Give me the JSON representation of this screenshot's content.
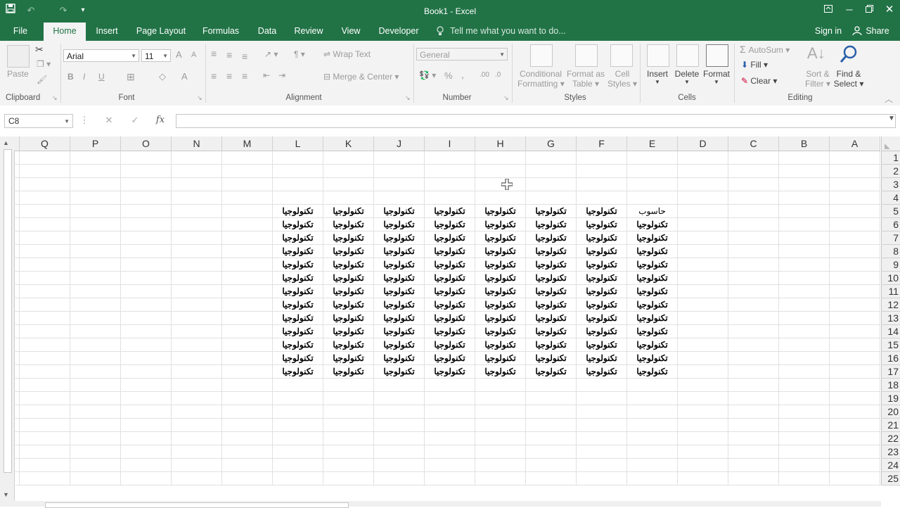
{
  "window": {
    "title": "Book1 - Excel",
    "qat": [
      "save-icon",
      "undo-icon",
      "redo-icon",
      "customize-icon"
    ],
    "controls": [
      "ribbon-display-icon",
      "minimize-icon",
      "restore-icon",
      "close-icon"
    ]
  },
  "tabs": [
    "File",
    "Home",
    "Insert",
    "Page Layout",
    "Formulas",
    "Data",
    "Review",
    "View",
    "Developer"
  ],
  "active_tab": "Home",
  "tell_me": "Tell me what you want to do...",
  "sign_in": "Sign in",
  "share": "Share",
  "ribbon": {
    "clipboard": {
      "label": "Clipboard",
      "paste": "Paste"
    },
    "font": {
      "label": "Font",
      "name": "Arial",
      "size": "11",
      "bold": "B",
      "italic": "I",
      "underline": "U",
      "grow": "A",
      "shrink": "A",
      "color": "A"
    },
    "alignment": {
      "label": "Alignment",
      "wrap": "Wrap Text",
      "merge": "Merge & Center"
    },
    "number": {
      "label": "Number",
      "format": "General",
      "percent": "%",
      "comma": ","
    },
    "styles": {
      "label": "Styles",
      "conditional": "Conditional",
      "conditional2": "Formatting",
      "format_table": "Format as",
      "format_table2": "Table",
      "cell_styles": "Cell",
      "cell_styles2": "Styles"
    },
    "cells": {
      "label": "Cells",
      "insert": "Insert",
      "delete": "Delete",
      "format": "Format"
    },
    "editing": {
      "label": "Editing",
      "autosum": "AutoSum",
      "fill": "Fill",
      "clear": "Clear",
      "sort": "Sort &",
      "sort2": "Filter",
      "find": "Find &",
      "find2": "Select"
    }
  },
  "formula_bar": {
    "name_box": "C8",
    "fx": "fx",
    "cancel": "✕",
    "enter": "✓",
    "value": ""
  },
  "grid": {
    "columns": [
      "Q",
      "P",
      "O",
      "N",
      "M",
      "L",
      "K",
      "J",
      "I",
      "H",
      "G",
      "F",
      "E",
      "D",
      "C",
      "B",
      "A"
    ],
    "rows": [
      1,
      2,
      3,
      4,
      5,
      6,
      7,
      8,
      9,
      10,
      11,
      12,
      13,
      14,
      15,
      16,
      17,
      18,
      19,
      20,
      21,
      22,
      23,
      24,
      25
    ],
    "header_cell": {
      "column": "E",
      "row": 5,
      "text": "حاسوب"
    },
    "fill_text": "تكنولوجيا",
    "fill_columns": [
      "L",
      "K",
      "J",
      "I",
      "H",
      "G",
      "F",
      "E"
    ],
    "fill_rows": [
      5,
      17
    ],
    "selected_cell": "C8"
  }
}
